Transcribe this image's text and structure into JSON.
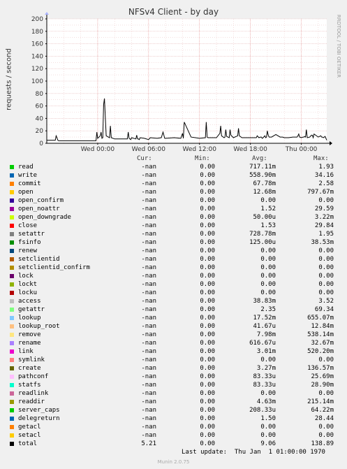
{
  "page": {
    "title": "NFSv4 Client - by day",
    "ylabel": "requests / second",
    "side_label": "RRDTOOL / TOBI OETIKER",
    "footer": "Munin 2.0.75",
    "last_update": "Last update:  Thu Jan  1 01:00:00 1970"
  },
  "legend_headers": {
    "cur": "Cur:",
    "min": "Min:",
    "avg": "Avg:",
    "max": "Max:"
  },
  "legend": [
    {
      "name": "read",
      "color": "#00cc00",
      "cur": "-nan",
      "min": "0.00",
      "avg": "717.11m",
      "max": "1.93"
    },
    {
      "name": "write",
      "color": "#0066b3",
      "cur": "-nan",
      "min": "0.00",
      "avg": "558.90m",
      "max": "34.16"
    },
    {
      "name": "commit",
      "color": "#ff8000",
      "cur": "-nan",
      "min": "0.00",
      "avg": "67.78m",
      "max": "2.58"
    },
    {
      "name": "open",
      "color": "#ffcc00",
      "cur": "-nan",
      "min": "0.00",
      "avg": "12.68m",
      "max": "797.67m"
    },
    {
      "name": "open_confirm",
      "color": "#330099",
      "cur": "-nan",
      "min": "0.00",
      "avg": "0.00",
      "max": "0.00"
    },
    {
      "name": "open_noattr",
      "color": "#990099",
      "cur": "-nan",
      "min": "0.00",
      "avg": "1.52",
      "max": "29.59"
    },
    {
      "name": "open_downgrade",
      "color": "#ccff00",
      "cur": "-nan",
      "min": "0.00",
      "avg": "50.00u",
      "max": "3.22m"
    },
    {
      "name": "close",
      "color": "#ff0000",
      "cur": "-nan",
      "min": "0.00",
      "avg": "1.53",
      "max": "29.84"
    },
    {
      "name": "setattr",
      "color": "#808080",
      "cur": "-nan",
      "min": "0.00",
      "avg": "728.78m",
      "max": "1.95"
    },
    {
      "name": "fsinfo",
      "color": "#008f00",
      "cur": "-nan",
      "min": "0.00",
      "avg": "125.00u",
      "max": "38.53m"
    },
    {
      "name": "renew",
      "color": "#00487d",
      "cur": "-nan",
      "min": "0.00",
      "avg": "0.00",
      "max": "0.00"
    },
    {
      "name": "setclientid",
      "color": "#b35a00",
      "cur": "-nan",
      "min": "0.00",
      "avg": "0.00",
      "max": "0.00"
    },
    {
      "name": "setclientid_confirm",
      "color": "#b38f00",
      "cur": "-nan",
      "min": "0.00",
      "avg": "0.00",
      "max": "0.00"
    },
    {
      "name": "lock",
      "color": "#6b006b",
      "cur": "-nan",
      "min": "0.00",
      "avg": "0.00",
      "max": "0.00"
    },
    {
      "name": "lockt",
      "color": "#8fb300",
      "cur": "-nan",
      "min": "0.00",
      "avg": "0.00",
      "max": "0.00"
    },
    {
      "name": "locku",
      "color": "#b30000",
      "cur": "-nan",
      "min": "0.00",
      "avg": "0.00",
      "max": "0.00"
    },
    {
      "name": "access",
      "color": "#bebebe",
      "cur": "-nan",
      "min": "0.00",
      "avg": "38.83m",
      "max": "3.52"
    },
    {
      "name": "getattr",
      "color": "#80ff80",
      "cur": "-nan",
      "min": "0.00",
      "avg": "2.35",
      "max": "69.34"
    },
    {
      "name": "lookup",
      "color": "#80c9ff",
      "cur": "-nan",
      "min": "0.00",
      "avg": "17.52m",
      "max": "655.07m"
    },
    {
      "name": "lookup_root",
      "color": "#ffc080",
      "cur": "-nan",
      "min": "0.00",
      "avg": "41.67u",
      "max": "12.84m"
    },
    {
      "name": "remove",
      "color": "#ffe680",
      "cur": "-nan",
      "min": "0.00",
      "avg": "7.98m",
      "max": "538.14m"
    },
    {
      "name": "rename",
      "color": "#aa80ff",
      "cur": "-nan",
      "min": "0.00",
      "avg": "616.67u",
      "max": "32.67m"
    },
    {
      "name": "link",
      "color": "#ee00cc",
      "cur": "-nan",
      "min": "0.00",
      "avg": "3.01m",
      "max": "520.20m"
    },
    {
      "name": "symlink",
      "color": "#ff8080",
      "cur": "-nan",
      "min": "0.00",
      "avg": "0.00",
      "max": "0.00"
    },
    {
      "name": "create",
      "color": "#666600",
      "cur": "-nan",
      "min": "0.00",
      "avg": "3.27m",
      "max": "136.57m"
    },
    {
      "name": "pathconf",
      "color": "#ffbfff",
      "cur": "-nan",
      "min": "0.00",
      "avg": "83.33u",
      "max": "25.69m"
    },
    {
      "name": "statfs",
      "color": "#00ffcc",
      "cur": "-nan",
      "min": "0.00",
      "avg": "83.33u",
      "max": "28.90m"
    },
    {
      "name": "readlink",
      "color": "#cc6699",
      "cur": "-nan",
      "min": "0.00",
      "avg": "0.00",
      "max": "0.00"
    },
    {
      "name": "readdir",
      "color": "#999900",
      "cur": "-nan",
      "min": "0.00",
      "avg": "4.63m",
      "max": "215.14m"
    },
    {
      "name": "server_caps",
      "color": "#00cc00",
      "cur": "-nan",
      "min": "0.00",
      "avg": "208.33u",
      "max": "64.22m"
    },
    {
      "name": "delegreturn",
      "color": "#0066b3",
      "cur": "-nan",
      "min": "0.00",
      "avg": "1.50",
      "max": "28.44"
    },
    {
      "name": "getacl",
      "color": "#ff8000",
      "cur": "-nan",
      "min": "0.00",
      "avg": "0.00",
      "max": "0.00"
    },
    {
      "name": "setacl",
      "color": "#ffcc00",
      "cur": "-nan",
      "min": "0.00",
      "avg": "0.00",
      "max": "0.00"
    },
    {
      "name": "total",
      "color": "#000000",
      "cur": "5.21",
      "min": "0.00",
      "avg": "9.06",
      "max": "138.89"
    }
  ],
  "chart_data": {
    "type": "line",
    "title": "NFSv4 Client - by day",
    "ylabel": "requests / second",
    "ylim": [
      0,
      200
    ],
    "yticks": [
      0,
      20,
      40,
      60,
      80,
      100,
      120,
      140,
      160,
      180,
      200
    ],
    "x_tick_labels": [
      "Wed 00:00",
      "Wed 06:00",
      "Wed 12:00",
      "Wed 18:00",
      "Thu 00:00"
    ],
    "x_tick_hours": [
      6,
      12,
      18,
      24,
      30
    ],
    "xlim_hours": [
      0,
      33
    ],
    "grid": true,
    "series": [
      {
        "name": "total",
        "color": "#000000",
        "x_hours": [
          0,
          1.0,
          1.1,
          1.2,
          1.3,
          1.4,
          2,
          4,
          5.8,
          5.9,
          6.0,
          6.3,
          6.4,
          6.5,
          6.6,
          6.7,
          6.8,
          7,
          7.4,
          7.5,
          7.6,
          8,
          9.5,
          9.6,
          9.7,
          9.8,
          9.9,
          10,
          10.5,
          10.6,
          10.7,
          10.8,
          10.9,
          11,
          11.5,
          12,
          12.2,
          13,
          13.5,
          13.7,
          13.8,
          13.9,
          14,
          15,
          15.8,
          16,
          16.1,
          16.2,
          17,
          18,
          18.7,
          18.8,
          18.9,
          19,
          20,
          20.4,
          20.5,
          20.6,
          20.9,
          21,
          21.1,
          21.2,
          21.5,
          21.6,
          21.7,
          22,
          22.5,
          22.6,
          22.7,
          22.9,
          23,
          23.5,
          24,
          24.5,
          24.6,
          24.7,
          24.8,
          25,
          25.2,
          25.3,
          25.4,
          25.5,
          25.7,
          25.8,
          25.9,
          26,
          26.1,
          26.2,
          26.5,
          27,
          27.5,
          27.6,
          27.8,
          28,
          28.5,
          29,
          29.5,
          29.6,
          29.7,
          29.8,
          30,
          30.2,
          30.3,
          30.4,
          30.5,
          30.6,
          30.7,
          31,
          31.2,
          31.3,
          31.4,
          31.5,
          32,
          32.3,
          32.4,
          32.5,
          32.6,
          32.7,
          32.8,
          33
        ],
        "values": [
          5,
          5,
          12,
          9,
          5,
          4,
          4,
          4,
          4,
          18,
          8,
          12,
          18,
          8,
          9,
          62,
          72,
          12,
          9,
          28,
          9,
          7,
          7,
          18,
          8,
          7,
          6,
          9,
          7,
          13,
          7,
          7,
          6,
          9,
          8,
          6,
          9,
          8,
          9,
          18,
          13,
          8,
          8,
          9,
          8,
          16,
          8,
          34,
          10,
          8,
          9,
          34,
          10,
          9,
          9,
          16,
          28,
          12,
          9,
          10,
          22,
          11,
          9,
          22,
          13,
          9,
          12,
          24,
          12,
          10,
          9,
          9,
          9,
          9,
          9,
          9,
          12,
          9,
          10,
          10,
          8,
          9,
          12,
          9,
          10,
          20,
          13,
          10,
          10,
          14,
          10,
          10,
          10,
          9,
          9,
          10,
          10,
          12,
          15,
          10,
          9,
          10,
          10,
          11,
          10,
          22,
          9,
          10,
          13,
          13,
          9,
          15,
          10,
          12,
          10,
          10,
          9,
          10,
          11,
          5,
          20,
          5
        ]
      }
    ]
  }
}
